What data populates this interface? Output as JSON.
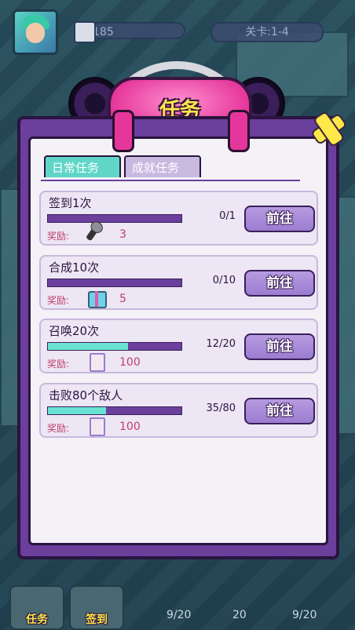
{
  "topbar": {
    "coins": "185",
    "level": "关卡:1-4"
  },
  "header": {
    "title": "任务"
  },
  "tabs": [
    {
      "label": "日常任务",
      "active": true
    },
    {
      "label": "成就任务",
      "active": false
    }
  ],
  "tasks": [
    {
      "title": "签到1次",
      "progress_text": "0/1",
      "progress": 0.0,
      "reward_label": "奖励:",
      "reward_icon": "microphone-icon",
      "reward_value": "3",
      "button": "前往"
    },
    {
      "title": "合成10次",
      "progress_text": "0/10",
      "progress": 0.0,
      "reward_label": "奖励:",
      "reward_icon": "gift-box-icon",
      "reward_value": "5",
      "button": "前往"
    },
    {
      "title": "召唤20次",
      "progress_text": "12/20",
      "progress": 0.6,
      "reward_label": "奖励:",
      "reward_icon": "scroll-icon",
      "reward_value": "100",
      "button": "前往"
    },
    {
      "title": "击败80个敌人",
      "progress_text": "35/80",
      "progress": 0.4375,
      "reward_label": "奖励:",
      "reward_icon": "scroll-icon",
      "reward_value": "100",
      "button": "前往"
    }
  ],
  "bottomnav": {
    "items": [
      {
        "label": "任务",
        "icon": "task-icon"
      },
      {
        "label": "签到",
        "icon": "checkin-icon"
      }
    ],
    "counts": [
      "9/20",
      "20",
      "9/20"
    ]
  },
  "colors": {
    "panel": "#6b3f9c",
    "accent_pink": "#e5369b",
    "teal": "#5fd6c8",
    "title_yellow": "#ffe84a"
  }
}
